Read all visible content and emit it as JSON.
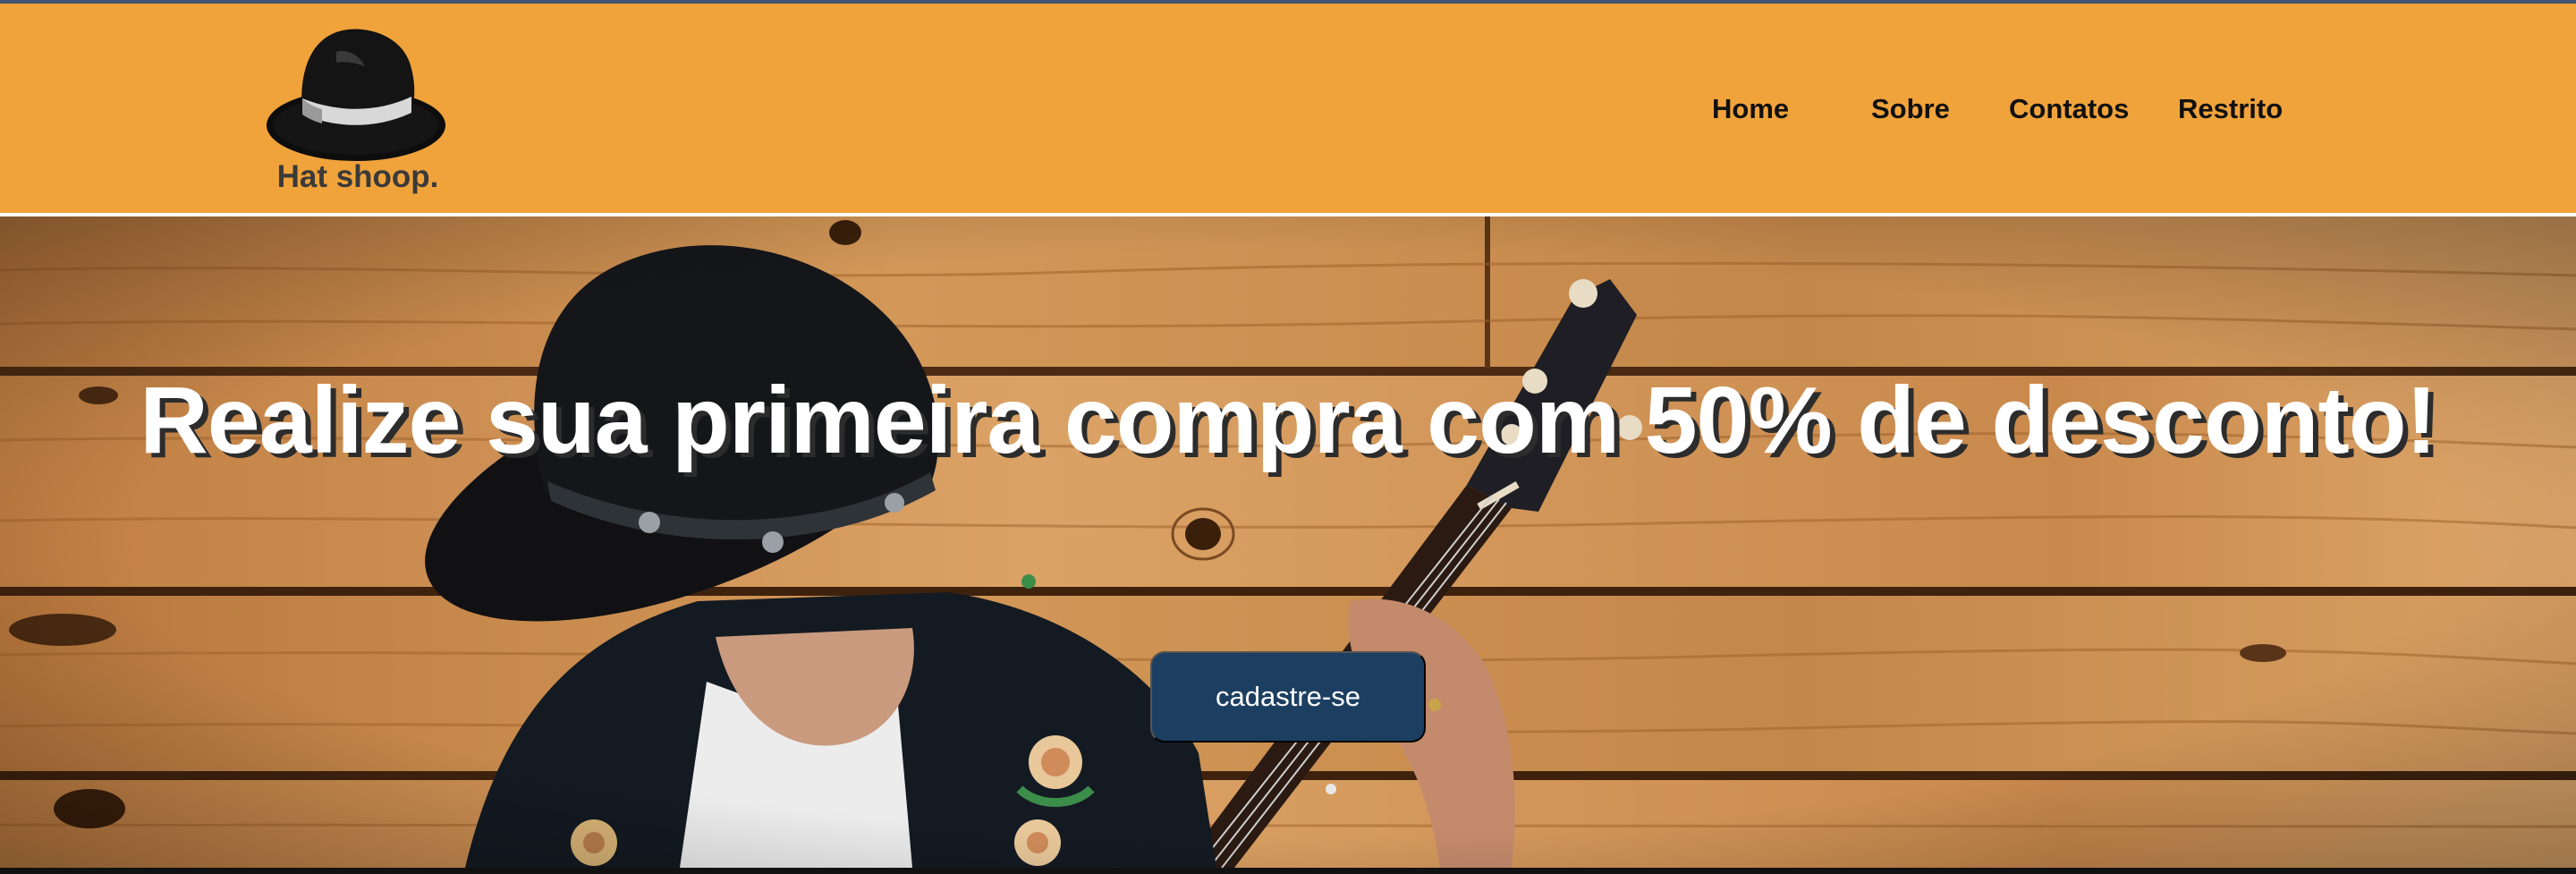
{
  "brand": {
    "name": "Hat shoop.",
    "logo_icon": "hat-icon"
  },
  "nav": {
    "items": [
      {
        "label": "Home"
      },
      {
        "label": "Sobre"
      },
      {
        "label": "Contatos"
      },
      {
        "label": "Restrito"
      }
    ]
  },
  "hero": {
    "headline": "Realize sua primeira compra com 50% de desconto!",
    "cta_label": "cadastre-se",
    "background_image": "musician-with-hat-playing-banjo-on-wooden-wall"
  },
  "colors": {
    "header_bg": "#f1a33b",
    "button_bg": "#1c3f61",
    "wood": "#c98a4b"
  }
}
